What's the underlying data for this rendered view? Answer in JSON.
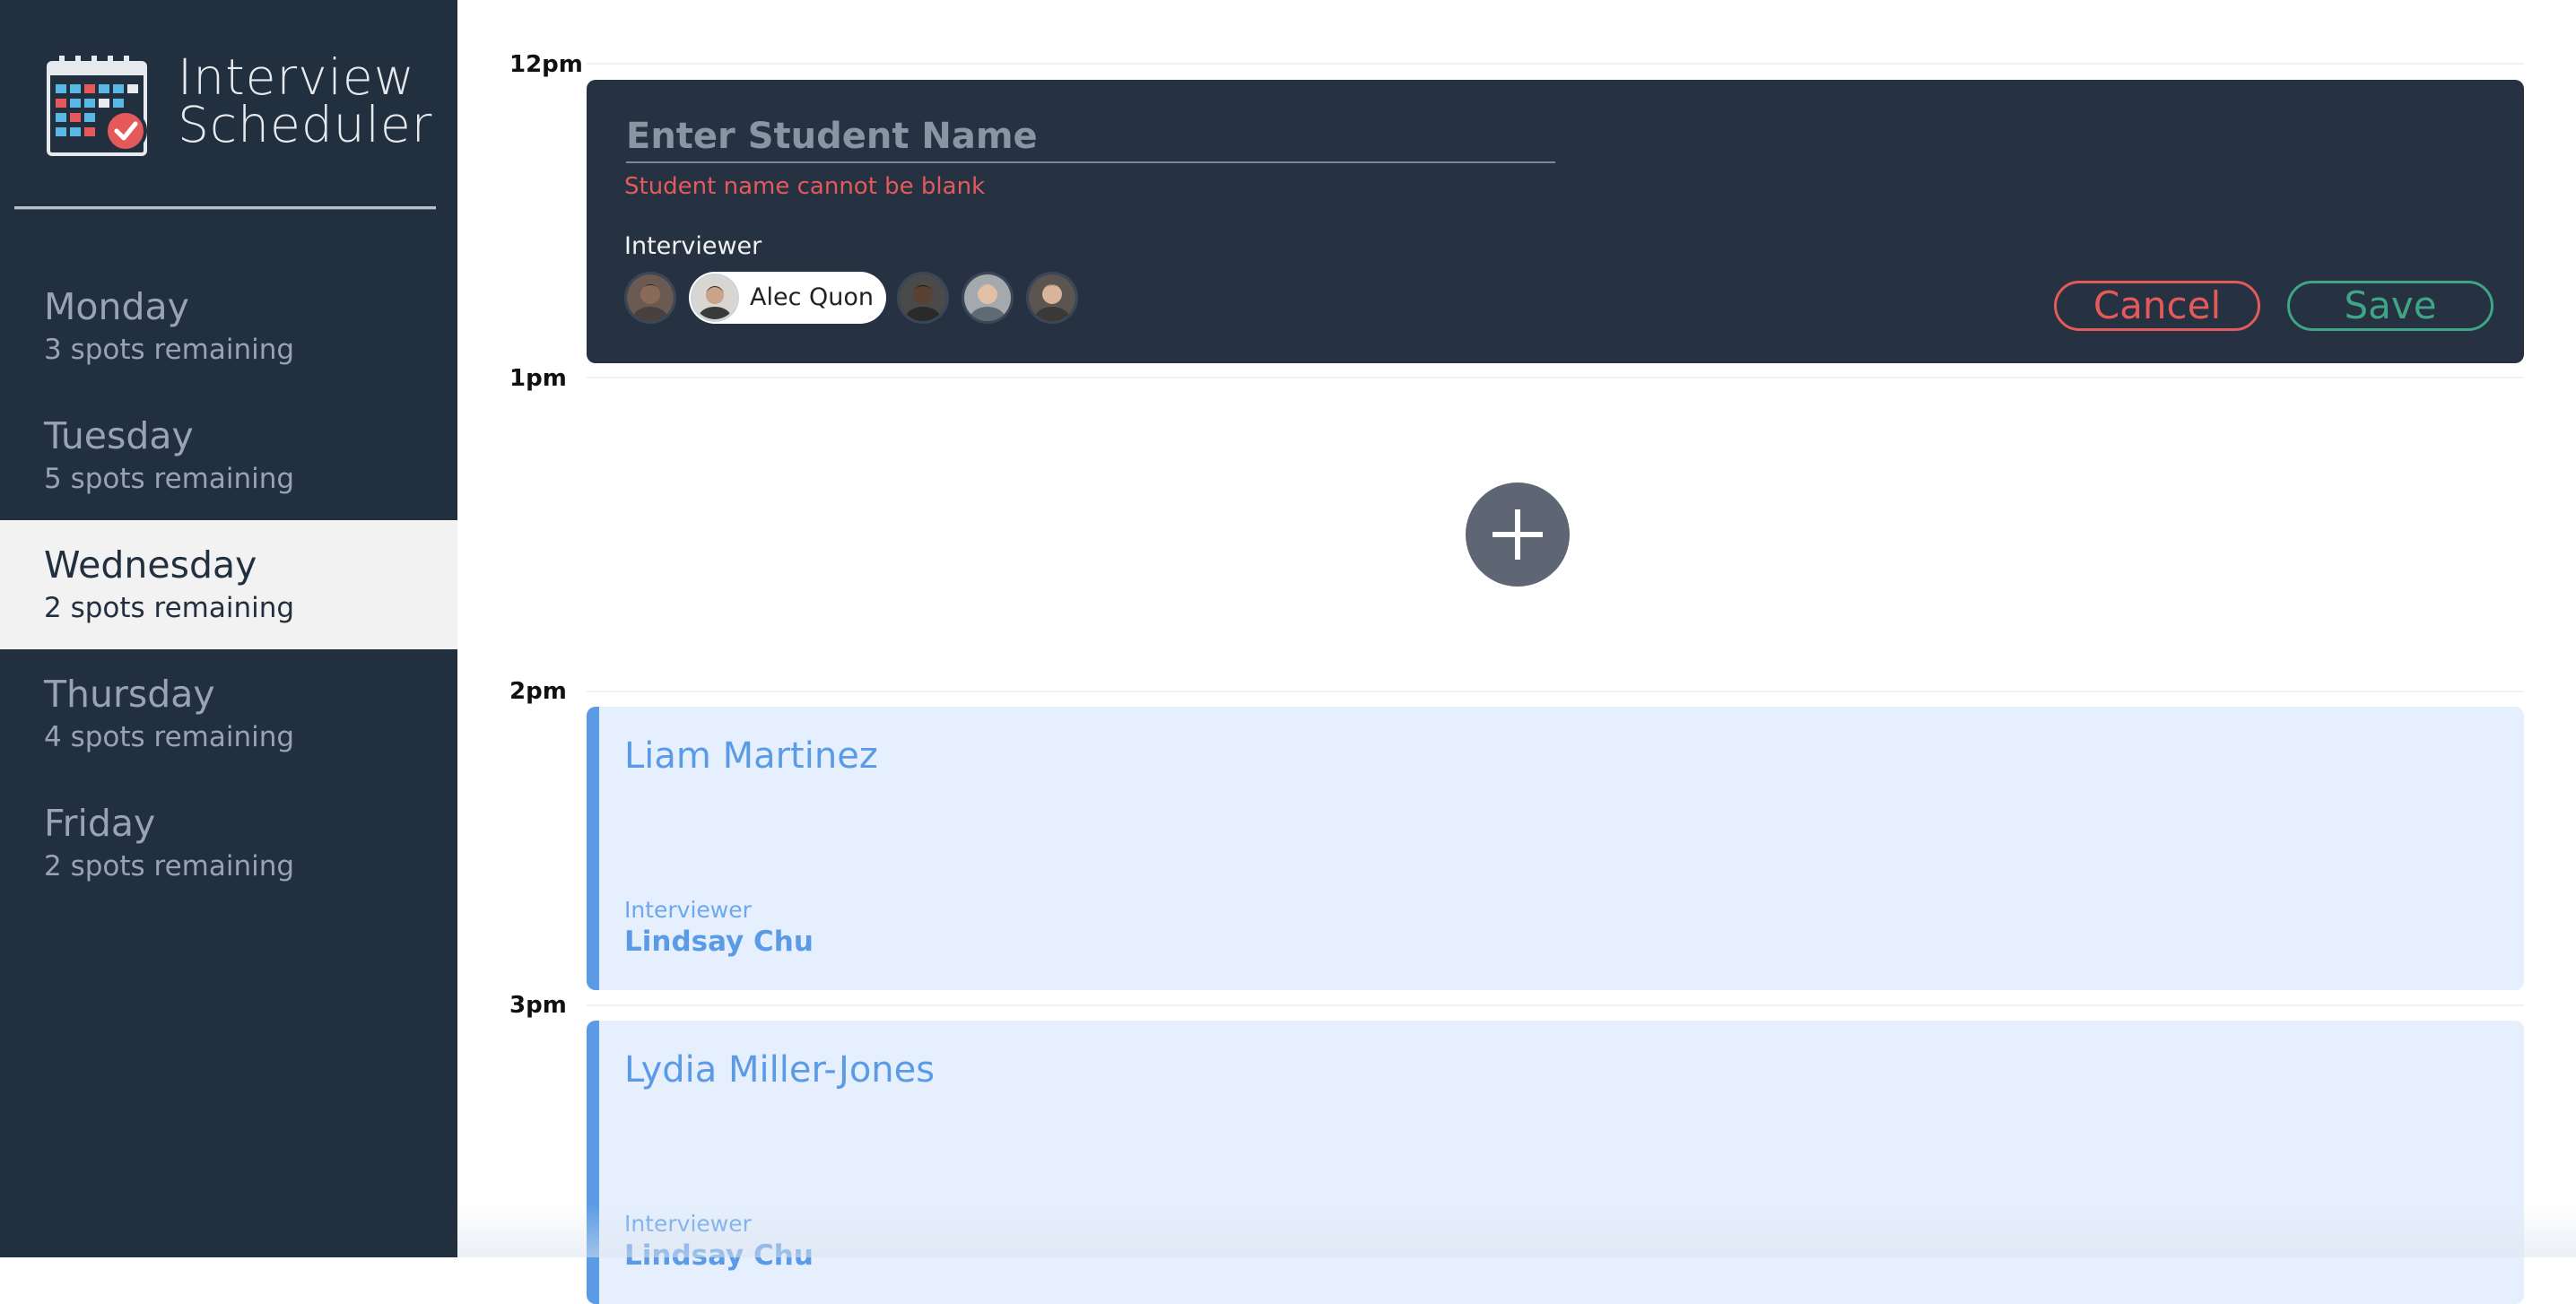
{
  "app": {
    "title_line1": "Interview",
    "title_line2": "Scheduler",
    "logo_icon": "calendar-check-icon"
  },
  "days": [
    {
      "name": "Monday",
      "spots": "3 spots remaining",
      "selected": false
    },
    {
      "name": "Tuesday",
      "spots": "5 spots remaining",
      "selected": false
    },
    {
      "name": "Wednesday",
      "spots": "2 spots remaining",
      "selected": true
    },
    {
      "name": "Thursday",
      "spots": "4 spots remaining",
      "selected": false
    },
    {
      "name": "Friday",
      "spots": "2 spots remaining",
      "selected": false
    }
  ],
  "schedule": {
    "times": [
      "12pm",
      "1pm",
      "2pm",
      "3pm"
    ],
    "form": {
      "name_value": "",
      "name_placeholder": "Enter Student Name",
      "error": "Student name cannot be blank",
      "interviewer_heading": "Interviewer",
      "selected_interviewer": "Alec Quon",
      "cancel_label": "Cancel",
      "save_label": "Save"
    },
    "add_icon": "plus-icon",
    "appointments": [
      {
        "student": "Liam Martinez",
        "interviewer_label": "Interviewer",
        "interviewer": "Lindsay Chu"
      },
      {
        "student": "Lydia Miller-Jones",
        "interviewer_label": "Interviewer",
        "interviewer": "Lindsay Chu"
      }
    ]
  },
  "colors": {
    "sidebar_bg": "#222f3e",
    "selected_day_bg": "#f2f2f2",
    "error": "#e45a5a",
    "save": "#3fa585",
    "appointment_accent": "#5b9be6",
    "appointment_bg": "#e6effd"
  }
}
